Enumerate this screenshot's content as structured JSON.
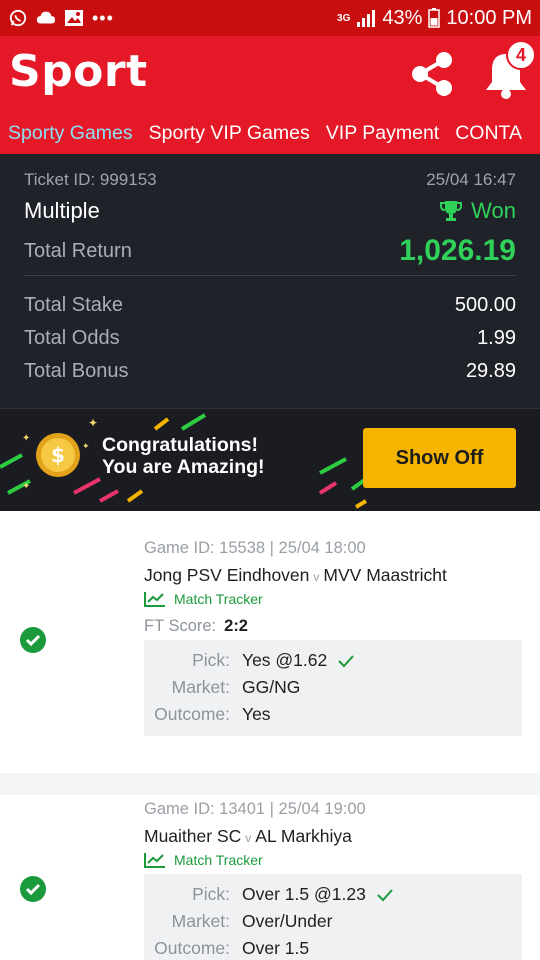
{
  "status_bar": {
    "network": "3G",
    "battery": "43%",
    "time": "10:00 PM",
    "icons": [
      "whatsapp-icon",
      "cloud-icon",
      "image-icon",
      "more-dots-icon",
      "signal-icon",
      "battery-icon"
    ]
  },
  "header": {
    "title": "Sport",
    "notification_count": "4",
    "icons": [
      "share-icon",
      "bell-icon"
    ]
  },
  "tabs": [
    {
      "label": "Sporty Games",
      "active": true
    },
    {
      "label": "Sporty VIP Games",
      "active": false
    },
    {
      "label": "VIP Payment",
      "active": false
    },
    {
      "label": "CONTA",
      "active": false
    }
  ],
  "ticket": {
    "id_text": "Ticket ID: 999153",
    "datetime": "25/04 16:47",
    "type": "Multiple",
    "status": "Won",
    "total_return_label": "Total Return",
    "total_return": "1,026.19",
    "total_stake_label": "Total Stake",
    "total_stake": "500.00",
    "total_odds_label": "Total Odds",
    "total_odds": "1.99",
    "total_bonus_label": "Total Bonus",
    "total_bonus": "29.89"
  },
  "banner": {
    "line1": "Congratulations!",
    "line2": "You are Amazing!",
    "button": "Show Off"
  },
  "selections": [
    {
      "game_line": "Game ID: 15538 | 25/04 18:00",
      "home": "Jong PSV Eindhoven",
      "vs": "v",
      "away": "MVV Maastricht",
      "tracker": "Match Tracker",
      "ft_label": "FT Score:",
      "ft_score": "2:2",
      "pick_label": "Pick:",
      "pick": "Yes @1.62",
      "market_label": "Market:",
      "market": "GG/NG",
      "outcome_label": "Outcome:",
      "outcome": "Yes"
    },
    {
      "game_line": "Game ID: 13401 | 25/04 19:00",
      "home": "Muaither SC",
      "vs": "v",
      "away": "AL Markhiya",
      "tracker": "Match Tracker",
      "pick_label": "Pick:",
      "pick": "Over 1.5 @1.23",
      "market_label": "Market:",
      "market": "Over/Under",
      "outcome_label": "Outcome:",
      "outcome": "Over 1.5"
    }
  ],
  "colors": {
    "brand_red": "#e41827",
    "status_red": "#c80e0e",
    "active_tab": "#8ce0f5",
    "won_green": "#30d158",
    "dark_panel": "#1f2229",
    "button_yellow": "#f5b400"
  }
}
